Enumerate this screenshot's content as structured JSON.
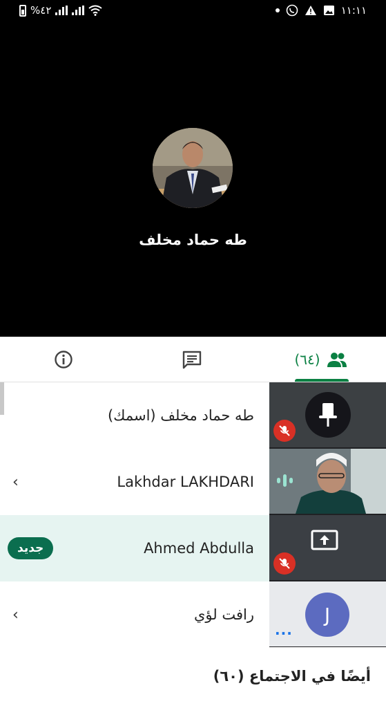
{
  "status_bar": {
    "battery_text": "%٤٢",
    "time": "١١:١١"
  },
  "main_speaker": {
    "name": "طه حماد مخلف"
  },
  "tabs": {
    "info_icon": "info-icon",
    "chat_icon": "chat-icon",
    "people_count": "(٦٤)",
    "people_icon": "people-icon",
    "active_color": "#0b8043"
  },
  "participants": [
    {
      "name": "طه حماد مخلف (اسمك)",
      "has_chevron": false
    },
    {
      "name": "Lakhdar LAKHDARI",
      "has_chevron": true
    },
    {
      "name": "Ahmed Abdulla",
      "badge": "جديد",
      "highlighted": true
    },
    {
      "name": "رافت لؤي",
      "has_chevron": true
    }
  ],
  "thumbnails": [
    {
      "kind": "self",
      "icon": "pin-icon",
      "muted": true
    },
    {
      "kind": "video",
      "audio_icon": "audio-level-icon"
    },
    {
      "kind": "screen-share",
      "icon": "present-screen-icon",
      "muted": true
    },
    {
      "kind": "avatar",
      "initial": "J",
      "more": "..."
    }
  ],
  "section": {
    "title": "أيضًا في الاجتماع (٦٠)"
  }
}
